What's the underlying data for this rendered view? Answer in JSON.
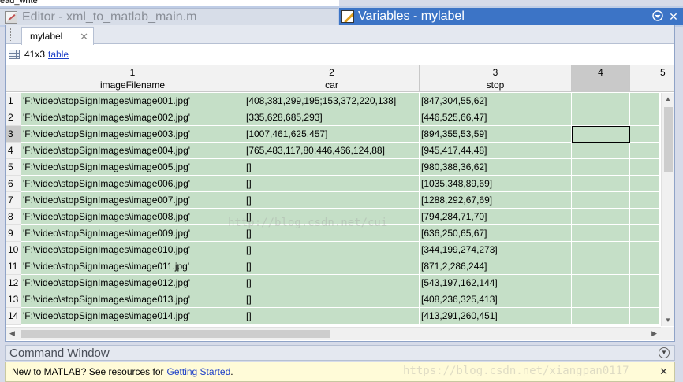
{
  "top_fragment": "ead_write",
  "editor_tab": {
    "title": "Editor - xml_to_matlab_main.m"
  },
  "variables_tab": {
    "title": "Variables - mylabel"
  },
  "doc_tab": {
    "label": "mylabel"
  },
  "info": {
    "dims": "41x3",
    "type_link": "table"
  },
  "table": {
    "columns": [
      {
        "num": "1",
        "name": "imageFilename"
      },
      {
        "num": "2",
        "name": "car"
      },
      {
        "num": "3",
        "name": "stop"
      },
      {
        "num": "4",
        "name": ""
      },
      {
        "num": "5",
        "name": ""
      }
    ],
    "selected_row": 3,
    "rows": [
      {
        "n": "1",
        "c1": "'F:\\video\\stopSignImages\\image001.jpg'",
        "c2": "[408,381,299,195;153,372,220,138]",
        "c3": "[847,304,55,62]"
      },
      {
        "n": "2",
        "c1": "'F:\\video\\stopSignImages\\image002.jpg'",
        "c2": "[335,628,685,293]",
        "c3": "[446,525,66,47]"
      },
      {
        "n": "3",
        "c1": "'F:\\video\\stopSignImages\\image003.jpg'",
        "c2": "[1007,461,625,457]",
        "c3": "[894,355,53,59]"
      },
      {
        "n": "4",
        "c1": "'F:\\video\\stopSignImages\\image004.jpg'",
        "c2": "[765,483,117,80;446,466,124,88]",
        "c3": "[945,417,44,48]"
      },
      {
        "n": "5",
        "c1": "'F:\\video\\stopSignImages\\image005.jpg'",
        "c2": "[]",
        "c3": "[980,388,36,62]"
      },
      {
        "n": "6",
        "c1": "'F:\\video\\stopSignImages\\image006.jpg'",
        "c2": "[]",
        "c3": "[1035,348,89,69]"
      },
      {
        "n": "7",
        "c1": "'F:\\video\\stopSignImages\\image007.jpg'",
        "c2": "[]",
        "c3": "[1288,292,67,69]"
      },
      {
        "n": "8",
        "c1": "'F:\\video\\stopSignImages\\image008.jpg'",
        "c2": "[]",
        "c3": "[794,284,71,70]"
      },
      {
        "n": "9",
        "c1": "'F:\\video\\stopSignImages\\image009.jpg'",
        "c2": "[]",
        "c3": "[636,250,65,67]"
      },
      {
        "n": "10",
        "c1": "'F:\\video\\stopSignImages\\image010.jpg'",
        "c2": "[]",
        "c3": "[344,199,274,273]"
      },
      {
        "n": "11",
        "c1": "'F:\\video\\stopSignImages\\image011.jpg'",
        "c2": "[]",
        "c3": "[871,2,286,244]"
      },
      {
        "n": "12",
        "c1": "'F:\\video\\stopSignImages\\image012.jpg'",
        "c2": "[]",
        "c3": "[543,197,162,144]"
      },
      {
        "n": "13",
        "c1": "'F:\\video\\stopSignImages\\image013.jpg'",
        "c2": "[]",
        "c3": "[408,236,325,413]"
      },
      {
        "n": "14",
        "c1": "'F:\\video\\stopSignImages\\image014.jpg'",
        "c2": "[]",
        "c3": "[413,291,260,451]"
      }
    ]
  },
  "watermark_table": "http://blog.csdn.net/cui",
  "watermark_cmd": "https://blog.csdn.net/xiangpan0117",
  "command_window": {
    "title": "Command Window",
    "message": "New to MATLAB? See resources for",
    "link": "Getting Started",
    "period": "."
  },
  "colors": {
    "cell_fill": "#c5dfc7",
    "active_tab": "#3c74c6",
    "link": "#1e40c8",
    "banner": "#fffbd8"
  },
  "icons": {
    "editor": "editor-icon",
    "variables": "variables-icon",
    "close": "close-icon",
    "options": "chevron-down-icon",
    "table": "table-grid-icon"
  }
}
